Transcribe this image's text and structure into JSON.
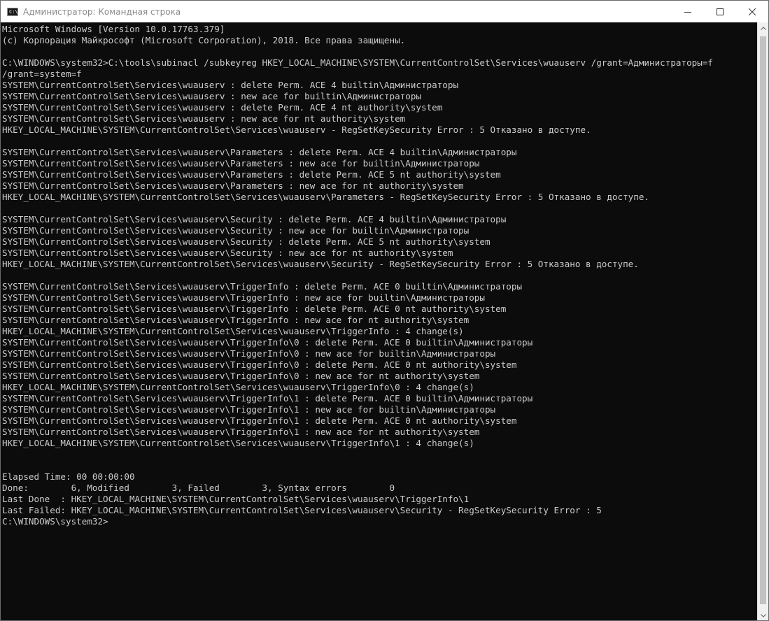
{
  "window": {
    "title": "Администратор: Командная строка",
    "icon": "cmd-icon"
  },
  "controls": {
    "minimize": "minimize-icon",
    "maximize": "maximize-icon",
    "close": "close-icon"
  },
  "console": {
    "lines": [
      "Microsoft Windows [Version 10.0.17763.379]",
      "(c) Корпорация Майкрософт (Microsoft Corporation), 2018. Все права защищены.",
      "",
      "C:\\WINDOWS\\system32>C:\\tools\\subinacl /subkeyreg HKEY_LOCAL_MACHINE\\SYSTEM\\CurrentControlSet\\Services\\wuauserv /grant=Администраторы=f",
      "/grant=system=f",
      "SYSTEM\\CurrentControlSet\\Services\\wuauserv : delete Perm. ACE 4 builtin\\Администраторы",
      "SYSTEM\\CurrentControlSet\\Services\\wuauserv : new ace for builtin\\Администраторы",
      "SYSTEM\\CurrentControlSet\\Services\\wuauserv : delete Perm. ACE 4 nt authority\\system",
      "SYSTEM\\CurrentControlSet\\Services\\wuauserv : new ace for nt authority\\system",
      "HKEY_LOCAL_MACHINE\\SYSTEM\\CurrentControlSet\\Services\\wuauserv - RegSetKeySecurity Error : 5 Отказано в доступе.",
      "",
      "SYSTEM\\CurrentControlSet\\Services\\wuauserv\\Parameters : delete Perm. ACE 4 builtin\\Администраторы",
      "SYSTEM\\CurrentControlSet\\Services\\wuauserv\\Parameters : new ace for builtin\\Администраторы",
      "SYSTEM\\CurrentControlSet\\Services\\wuauserv\\Parameters : delete Perm. ACE 5 nt authority\\system",
      "SYSTEM\\CurrentControlSet\\Services\\wuauserv\\Parameters : new ace for nt authority\\system",
      "HKEY_LOCAL_MACHINE\\SYSTEM\\CurrentControlSet\\Services\\wuauserv\\Parameters - RegSetKeySecurity Error : 5 Отказано в доступе.",
      "",
      "SYSTEM\\CurrentControlSet\\Services\\wuauserv\\Security : delete Perm. ACE 4 builtin\\Администраторы",
      "SYSTEM\\CurrentControlSet\\Services\\wuauserv\\Security : new ace for builtin\\Администраторы",
      "SYSTEM\\CurrentControlSet\\Services\\wuauserv\\Security : delete Perm. ACE 5 nt authority\\system",
      "SYSTEM\\CurrentControlSet\\Services\\wuauserv\\Security : new ace for nt authority\\system",
      "HKEY_LOCAL_MACHINE\\SYSTEM\\CurrentControlSet\\Services\\wuauserv\\Security - RegSetKeySecurity Error : 5 Отказано в доступе.",
      "",
      "SYSTEM\\CurrentControlSet\\Services\\wuauserv\\TriggerInfo : delete Perm. ACE 0 builtin\\Администраторы",
      "SYSTEM\\CurrentControlSet\\Services\\wuauserv\\TriggerInfo : new ace for builtin\\Администраторы",
      "SYSTEM\\CurrentControlSet\\Services\\wuauserv\\TriggerInfo : delete Perm. ACE 0 nt authority\\system",
      "SYSTEM\\CurrentControlSet\\Services\\wuauserv\\TriggerInfo : new ace for nt authority\\system",
      "HKEY_LOCAL_MACHINE\\SYSTEM\\CurrentControlSet\\Services\\wuauserv\\TriggerInfo : 4 change(s)",
      "SYSTEM\\CurrentControlSet\\Services\\wuauserv\\TriggerInfo\\0 : delete Perm. ACE 0 builtin\\Администраторы",
      "SYSTEM\\CurrentControlSet\\Services\\wuauserv\\TriggerInfo\\0 : new ace for builtin\\Администраторы",
      "SYSTEM\\CurrentControlSet\\Services\\wuauserv\\TriggerInfo\\0 : delete Perm. ACE 0 nt authority\\system",
      "SYSTEM\\CurrentControlSet\\Services\\wuauserv\\TriggerInfo\\0 : new ace for nt authority\\system",
      "HKEY_LOCAL_MACHINE\\SYSTEM\\CurrentControlSet\\Services\\wuauserv\\TriggerInfo\\0 : 4 change(s)",
      "SYSTEM\\CurrentControlSet\\Services\\wuauserv\\TriggerInfo\\1 : delete Perm. ACE 0 builtin\\Администраторы",
      "SYSTEM\\CurrentControlSet\\Services\\wuauserv\\TriggerInfo\\1 : new ace for builtin\\Администраторы",
      "SYSTEM\\CurrentControlSet\\Services\\wuauserv\\TriggerInfo\\1 : delete Perm. ACE 0 nt authority\\system",
      "SYSTEM\\CurrentControlSet\\Services\\wuauserv\\TriggerInfo\\1 : new ace for nt authority\\system",
      "HKEY_LOCAL_MACHINE\\SYSTEM\\CurrentControlSet\\Services\\wuauserv\\TriggerInfo\\1 : 4 change(s)",
      "",
      "",
      "Elapsed Time: 00 00:00:00",
      "Done:        6, Modified        3, Failed        3, Syntax errors        0",
      "Last Done  : HKEY_LOCAL_MACHINE\\SYSTEM\\CurrentControlSet\\Services\\wuauserv\\TriggerInfo\\1",
      "Last Failed: HKEY_LOCAL_MACHINE\\SYSTEM\\CurrentControlSet\\Services\\wuauserv\\Security - RegSetKeySecurity Error : 5",
      "C:\\WINDOWS\\system32>"
    ]
  },
  "colors": {
    "console_bg": "#0c0c0c",
    "console_text": "#cccccc",
    "titlebar_bg": "#ffffff",
    "title_text": "#8a8a8a"
  }
}
